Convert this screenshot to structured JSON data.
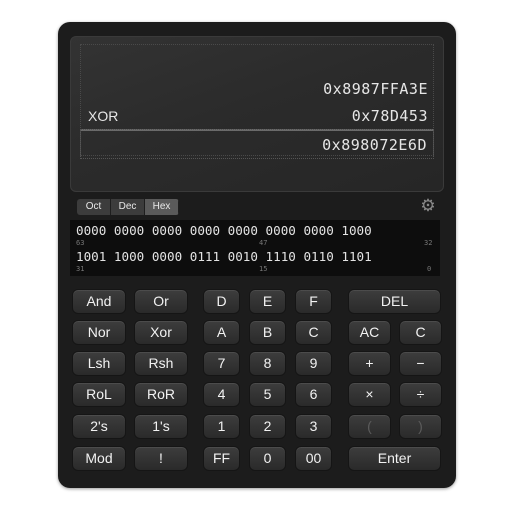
{
  "display": {
    "line1": {
      "value": "0x8987FFA3E"
    },
    "line2": {
      "operator": "XOR",
      "value": "0x78D453"
    },
    "line3": {
      "value": "0x898072E6D"
    }
  },
  "base_selector": [
    {
      "label": "Oct",
      "active": false
    },
    {
      "label": "Dec",
      "active": false
    },
    {
      "label": "Hex",
      "active": true
    }
  ],
  "settings_icon": "gear-icon",
  "binary": {
    "row_high": "0000 0000 0000 0000 0000 0000 0000 1000",
    "row_low": "1001 1000 0000 0111 0010 1110 0110 1101",
    "bit_labels": [
      "63",
      "47",
      "32",
      "31",
      "15",
      "0"
    ]
  },
  "keys": {
    "and": "And",
    "or": "Or",
    "d": "D",
    "e": "E",
    "f": "F",
    "del": "DEL",
    "nor": "Nor",
    "xor": "Xor",
    "a": "A",
    "b": "B",
    "c": "C",
    "ac": "AC",
    "clear": "C",
    "lsh": "Lsh",
    "rsh": "Rsh",
    "seven": "7",
    "eight": "8",
    "nine": "9",
    "plus": "+",
    "minus": "−",
    "rol": "RoL",
    "ror": "RoR",
    "four": "4",
    "five": "5",
    "six": "6",
    "multiply": "×",
    "divide": "÷",
    "twos": "2's",
    "ones": "1's",
    "one": "1",
    "two": "2",
    "three": "3",
    "lparen": "(",
    "rparen": ")",
    "mod": "Mod",
    "not": "!",
    "ff": "FF",
    "zero": "0",
    "double_zero": "00",
    "enter": "Enter"
  }
}
